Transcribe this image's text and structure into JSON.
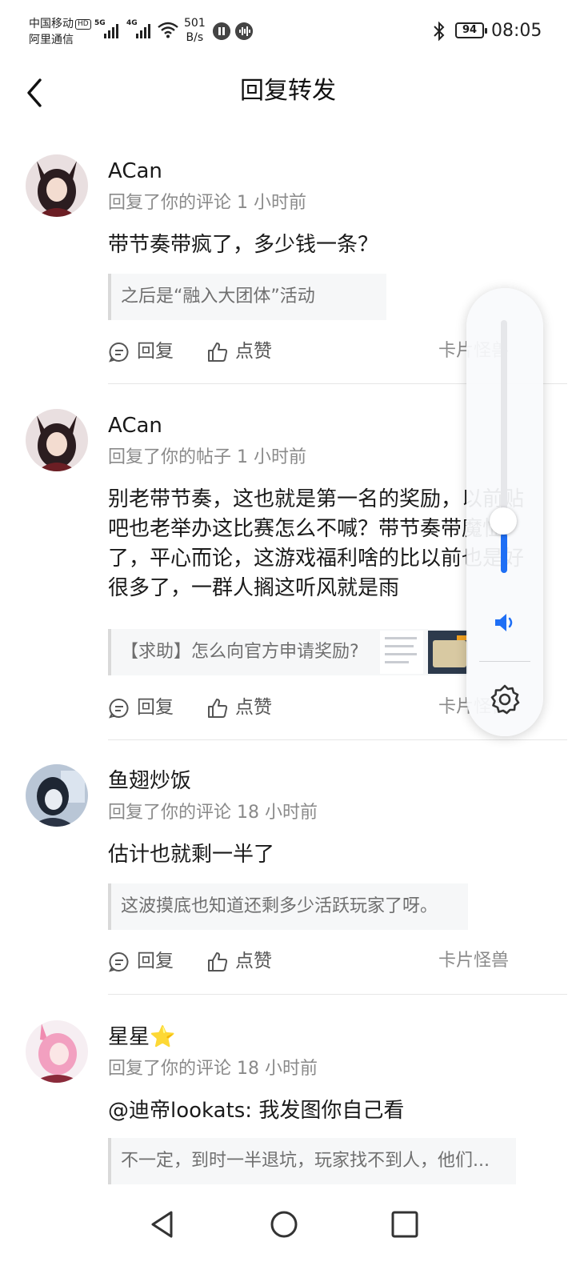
{
  "status_bar": {
    "carrier_1": "中国移动",
    "carrier_hd": "HD",
    "carrier_2": "阿里通信",
    "signal_1_label": "5G",
    "signal_2_label": "4G",
    "net_speed_value": "501",
    "net_speed_unit": "B/s",
    "battery": "94",
    "time": "08:05"
  },
  "header": {
    "title": "回复转发"
  },
  "items": [
    {
      "name": "ACan",
      "meta": "回复了你的评论 1 小时前",
      "content": "带节奏带疯了，多少钱一条？",
      "quote": "之后是“融入大团体”活动",
      "reply_label": "回复",
      "like_label": "点赞",
      "tag": "卡片怪兽"
    },
    {
      "name": "ACan",
      "meta": "回复了你的帖子 1 小时前",
      "content": "别老带节奏，这也就是第一名的奖励，以前贴吧也老举办这比赛怎么不喊？带节奏带魔怔了，平心而论，这游戏福利啥的比以前也是好很多了，一群人搁这听风就是雨",
      "quote": "【求助】怎么向官方申请奖励?",
      "reply_label": "回复",
      "like_label": "点赞",
      "tag": "卡片怪兽"
    },
    {
      "name": "鱼翅炒饭",
      "meta": "回复了你的评论 18 小时前",
      "content": "估计也就剩一半了",
      "quote": "这波摸底也知道还剩多少活跃玩家了呀。",
      "reply_label": "回复",
      "like_label": "点赞",
      "tag": "卡片怪兽"
    },
    {
      "name": "星星",
      "name_emoji": "⭐",
      "meta": "回复了你的评论 18 小时前",
      "content": "@迪帝lookats: 我发图你自己看",
      "quote": "不一定，到时一半退坑，玩家找不到人，他们..."
    }
  ],
  "volume": {
    "level": 0.16,
    "accent": "#1f6ff5"
  },
  "icons": {
    "back": "chevron-left-icon",
    "reply": "comment-icon",
    "like": "thumbs-up-icon",
    "volume": "speaker-icon",
    "settings": "gear-icon",
    "nav_back": "triangle-back-icon",
    "nav_home": "circle-home-icon",
    "nav_recents": "square-recents-icon"
  }
}
